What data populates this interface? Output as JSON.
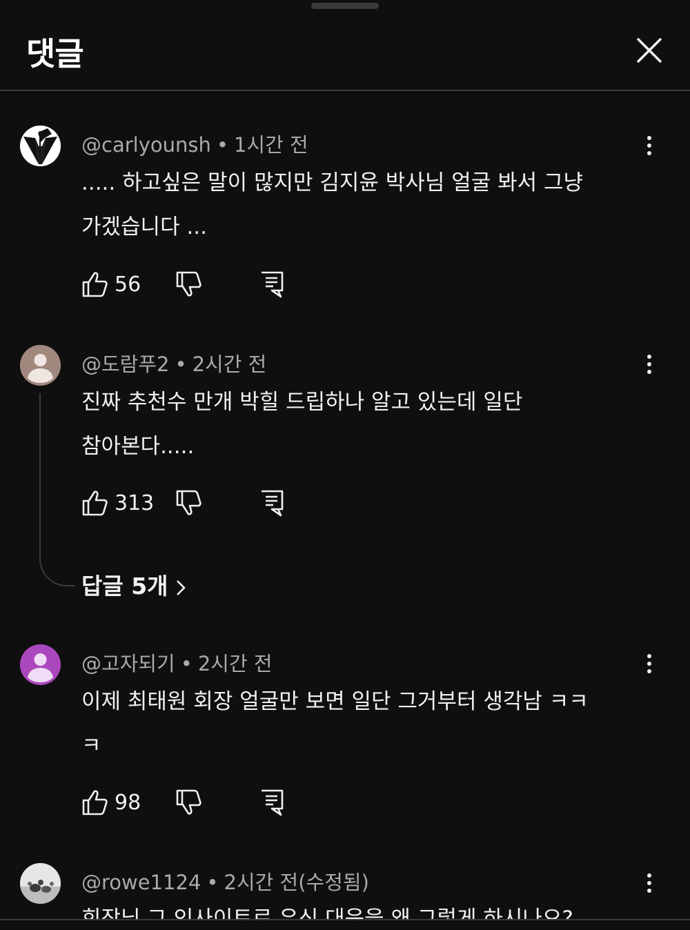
{
  "header": {
    "title": "댓글"
  },
  "comments": [
    {
      "handle": "@carlyounsh",
      "time": "1시간 전",
      "text": "..... 하고싶은 말이 많지만 김지윤 박사님 얼굴 봐서 그냥\n가겠습니다 ...",
      "likes": "56"
    },
    {
      "handle": "@도람푸2",
      "time": "2시간 전",
      "text": "진짜 추천수 만개 박힐 드립하나 알고 있는데 일단\n참아본다.....",
      "likes": "313",
      "replies_label": "답글 5개"
    },
    {
      "handle": "@고자되기",
      "time": "2시간 전",
      "text": "이제 최태원 회장 얼굴만 보면 일단 그거부터 생각남 ㅋㅋ\nㅋ",
      "likes": "98"
    },
    {
      "handle": "@rowe1124",
      "time": "2시간 전(수정됨)",
      "text": "회장님 그 인사이트로 유신 대응을 왜 그렇게 하시나요?"
    }
  ],
  "colors": {
    "background": "#0f0f0f",
    "avatar_brown": "#a1887f",
    "avatar_purple": "#ab47bc"
  }
}
